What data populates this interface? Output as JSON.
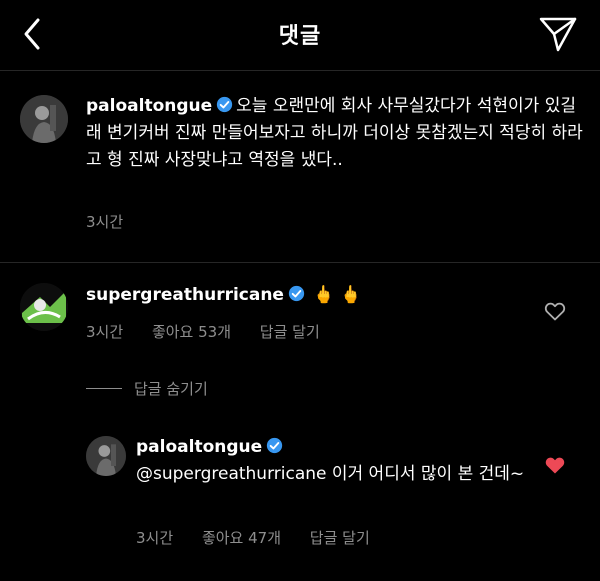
{
  "header": {
    "title": "댓글"
  },
  "post_caption": {
    "username": "paloaltongue",
    "text": "오늘 오랜만에 회사 사무실갔다가 석현이가  있길래 변기커버 진짜 만들어보자고 하니까 더이상 못참겠는지 적당히 하라고 형 진짜 사장맞냐고 역정을 냈다..",
    "time": "3시간"
  },
  "comments": [
    {
      "username": "supergreathurricane",
      "text": "🖕 🖕",
      "time": "3시간",
      "likes_label": "좋아요 53개",
      "reply_label": "답글 달기",
      "liked": false
    }
  ],
  "hide_replies_label": "답글 숨기기",
  "reply": {
    "username": "paloaltongue",
    "text": "@supergreathurricane 이거 어디서 많이 본 건데~",
    "time": "3시간",
    "likes_label": "좋아요 47개",
    "reply_label": "답글 달기",
    "liked": true
  },
  "colors": {
    "verified": "#3897f0",
    "heart_liked": "#ed4956",
    "meta": "#8e8e8e"
  }
}
